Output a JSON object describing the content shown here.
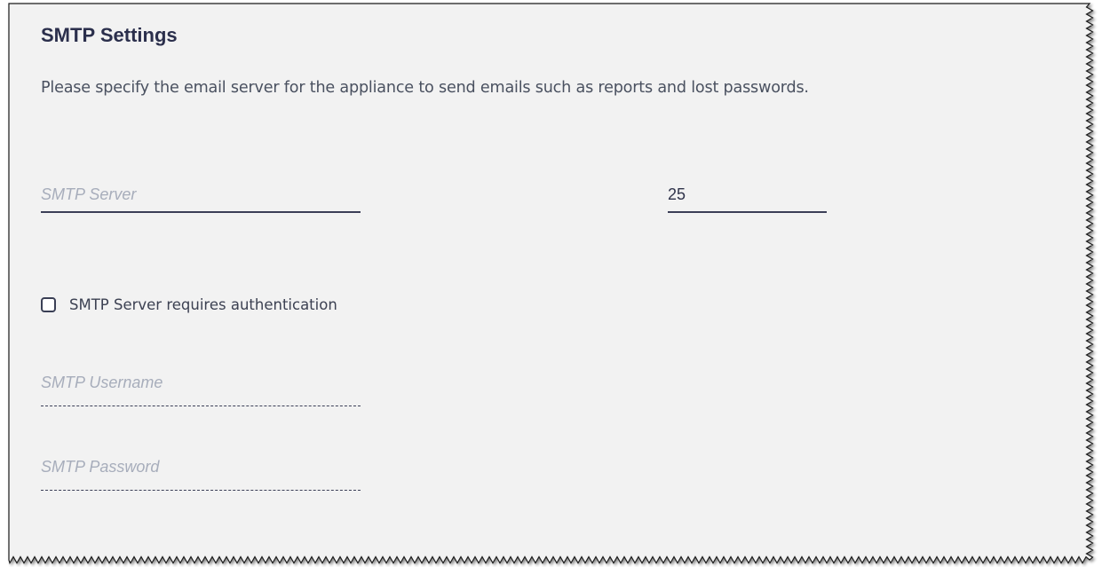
{
  "panel": {
    "title": "SMTP Settings",
    "description": "Please specify the email server for the appliance to send emails such as reports and lost passwords."
  },
  "fields": {
    "server": {
      "placeholder": "SMTP Server",
      "value": ""
    },
    "port": {
      "placeholder": "",
      "value": "25"
    },
    "username": {
      "placeholder": "SMTP Username",
      "value": ""
    },
    "password": {
      "placeholder": "SMTP Password",
      "value": ""
    }
  },
  "auth": {
    "label": "SMTP Server requires authentication",
    "checked": false
  },
  "colors": {
    "panel_background": "#f2f2f2",
    "title_text": "#2b2f4c",
    "underline": "#3b3f57",
    "placeholder": "#a7adbb"
  }
}
